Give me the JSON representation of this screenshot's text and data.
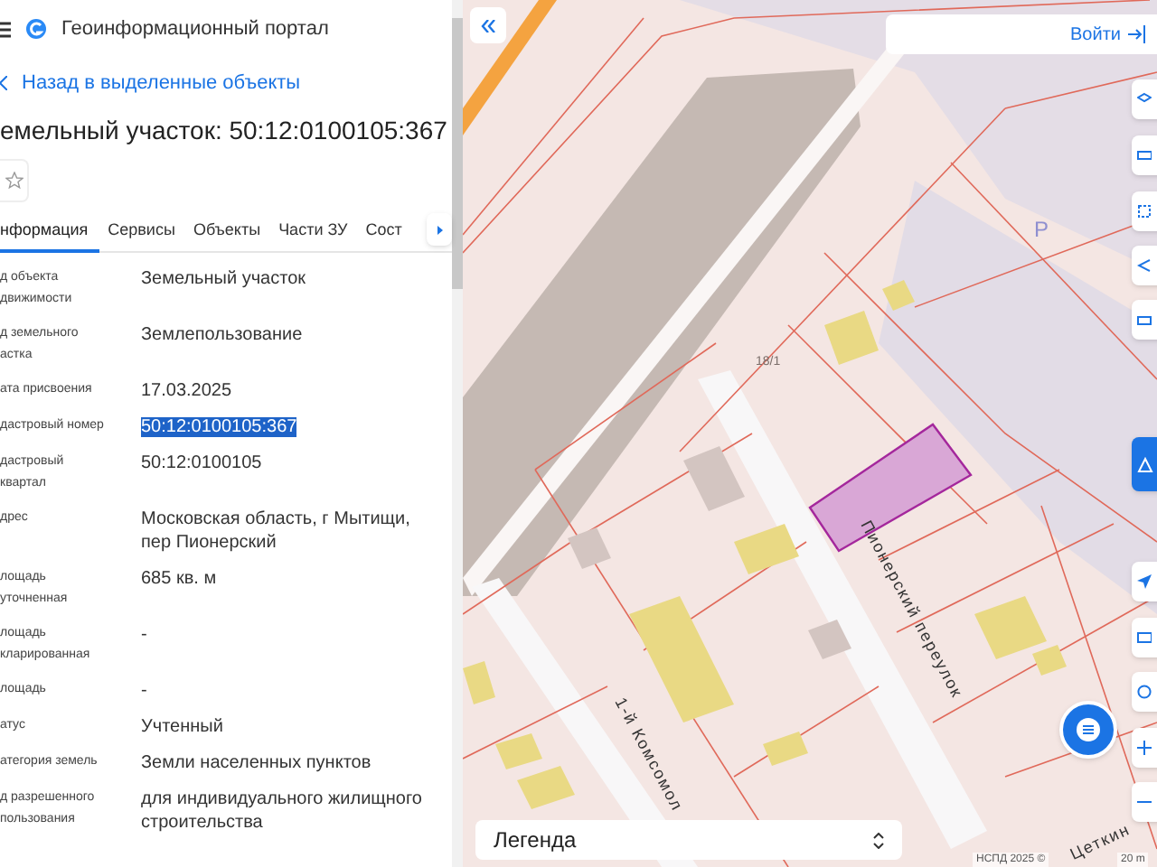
{
  "header": {
    "title": "Геоинформационный портал"
  },
  "back_link": "Назад в выделенные объекты",
  "object_title": "емельный участок: 50:12:0100105:367",
  "favorite": {
    "checked": false
  },
  "tabs": [
    {
      "label": "нформация",
      "selected": true
    },
    {
      "label": "Сервисы",
      "selected": false
    },
    {
      "label": "Объекты",
      "selected": false
    },
    {
      "label": "Части ЗУ",
      "selected": false
    },
    {
      "label": "Сост",
      "selected": false
    }
  ],
  "fields": [
    {
      "label": "д объекта движимости",
      "value": "Земельный участок",
      "highlighted": false
    },
    {
      "label": "д земельного астка",
      "value": "Землепользование",
      "highlighted": false
    },
    {
      "label": "ата присвоения",
      "value": "17.03.2025",
      "highlighted": false
    },
    {
      "label": "дастровый номер",
      "value": "50:12:0100105:367",
      "highlighted": true
    },
    {
      "label": "дастровый квартал",
      "value": "50:12:0100105",
      "highlighted": false
    },
    {
      "label": "дрес",
      "value": "Московская область, г Мытищи, пер Пионерский",
      "highlighted": false
    },
    {
      "label": "лощадь уточненная",
      "value": "685 кв. м",
      "highlighted": false
    },
    {
      "label": "лощадь кларированная",
      "value": "-",
      "highlighted": false
    },
    {
      "label": "лощадь",
      "value": "-",
      "highlighted": false
    },
    {
      "label": "атус",
      "value": "Учтенный",
      "highlighted": false
    },
    {
      "label": "атегория земель",
      "value": "Земли населенных пунктов",
      "highlighted": false
    },
    {
      "label": "д разрешенного пользования",
      "value": "для индивидуального жилищного строительства",
      "highlighted": false
    }
  ],
  "map": {
    "login": "Войти",
    "legend": "Легенда",
    "attribution": "НСПД 2025 ©",
    "scale": "20 m",
    "labels": [
      {
        "kind": "number",
        "text": "18/1"
      },
      {
        "kind": "parking",
        "text": "Р"
      },
      {
        "kind": "street",
        "text": "Пионерский переулок"
      },
      {
        "kind": "street",
        "text": "1-й Комсомол"
      },
      {
        "kind": "street",
        "text": "Цеткин"
      }
    ]
  }
}
